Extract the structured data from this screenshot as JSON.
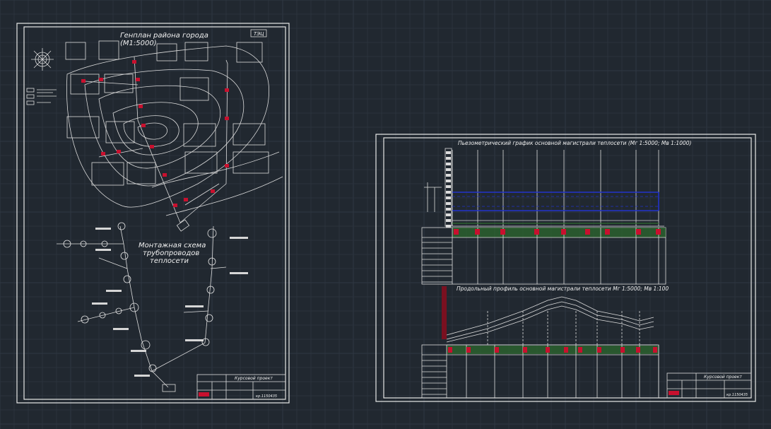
{
  "sheet_left": {
    "title_genplan": "Генплан района города",
    "scale_genplan": "(М1:5000)",
    "tag_tec": "ТЭЦ",
    "title_montage_line1": "Монтажная схема",
    "title_montage_line2": "трубопроводов",
    "title_montage_line3": "теплосети",
    "stamp_title": "Курсовой проект",
    "stamp_code": "кр.1150435"
  },
  "sheet_right": {
    "title_piezo": "Пьезометрический график основной магистрали теплосети (Мг 1:5000; Мв 1:1000)",
    "title_profile": "Продольный профиль основной магистрали теплосети  Мг 1:5000;  Мв 1:100",
    "stamp_title": "Курсовой проект",
    "stamp_code": "кр.1150435"
  },
  "colors": {
    "background": "#212830",
    "lines": "#e8e8e8",
    "accent_red": "#c8102e",
    "accent_blue": "#2233cc",
    "accent_green": "#2e6b2e"
  }
}
